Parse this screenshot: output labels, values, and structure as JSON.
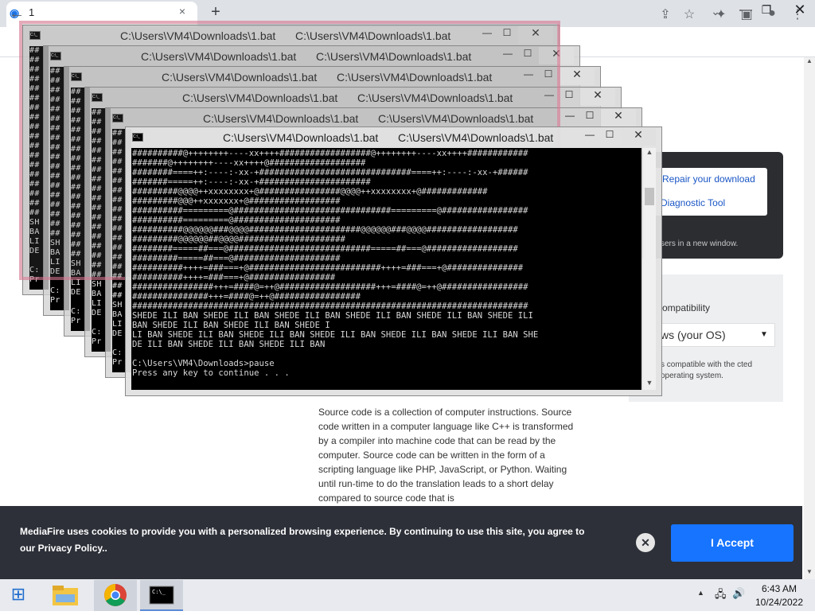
{
  "browser": {
    "tab_title": "1",
    "tab_close": "×",
    "new_tab": "+",
    "back": "←",
    "window_controls": {
      "chevron": "⌄",
      "minimize": "—",
      "maximize": "❐",
      "close": "✕"
    },
    "toolbar_icons": [
      "share-icon",
      "star-icon",
      "extensions-icon",
      "sidebar-icon",
      "profile-icon",
      "menu-icon"
    ]
  },
  "page": {
    "repair_link": "Repair your download",
    "diagnostic_link": "Diagnostic Tool",
    "new_window_text": "sers in a new window.",
    "compat_title": "ompatibility",
    "os_select_value": "ws (your OS)",
    "compat_desc": "s compatible with the cted operating system.",
    "article": "Source code is a collection of computer instructions. Source code written in a computer language like C++ is transformed by a compiler into machine code that can be read by the computer. Source code can be written in the form of a scripting language like PHP, JavaScript, or Python. Waiting until run-time to do the translation leads to a short delay compared to source code that is"
  },
  "cookie_banner": {
    "text": "MediaFire uses cookies to provide you with a personalized browsing experience. By continuing to use this site, you agree to our Privacy Policy..",
    "close": "✕",
    "accept_label": "I Accept"
  },
  "cmd_windows": {
    "title": "C:\\Users\\VM4\\Downloads\\1.bat",
    "title_echo": "C:\\Users\\VM4\\Downloads\\1.bat",
    "minimize": "—",
    "maximize": "☐",
    "close": "✕",
    "side_lines": [
      "SH",
      "BA",
      "LI",
      "DE",
      "",
      "C:",
      "Pr"
    ],
    "front_lines": [
      "##########@++++++++----xx++++##################@++++++++----xx++++############",
      "#######@++++++++----xx++++@###################",
      "########====++:----:-xx-+##############################====++:----:-xx-+######",
      "#######=====++:----:-xx-+######################",
      "#########@@@@++xxxxxxxx+@################@@@@++xxxxxxxx+@#############",
      "#########@@@++xxxxxxx+@##################",
      "##########=========@###############################=========@#################",
      "##########=========@#####################",
      "##########@@@@@@###@@@@######################@@@@@@###@@@@##################",
      "#########@@@@@@##@@@@#####################",
      "########=====##===@############################=====##===@##################",
      "#########=====##===@#####################",
      "##########++++=###===+@##########################++++=###===+@###############",
      "##########++++=###===+@#################",
      "################+++=####@=++@###################+++=####@=++@#################",
      "###############+++=####@=++@#################",
      "##############################################################################",
      "SHEDE ILI BAN SHEDE ILI BAN SHEDE ILI BAN SHEDE ILI BAN SHEDE ILI BAN SHEDE ILI",
      "BAN SHEDE ILI BAN SHEDE ILI BAN SHEDE I",
      "LI BAN SHEDE ILI BAN SHEDE ILI BAN SHEDE ILI BAN SHEDE ILI BAN SHEDE ILI BAN SHE",
      "DE ILI BAN SHEDE ILI BAN SHEDE ILI BAN",
      "",
      "C:\\Users\\VM4\\Downloads>pause",
      "Press any key to continue . . ."
    ]
  },
  "taskbar": {
    "time": "6:43 AM",
    "date": "10/24/2022",
    "tray_arrow": "▲",
    "net": "🖧",
    "vol": "🔊"
  }
}
